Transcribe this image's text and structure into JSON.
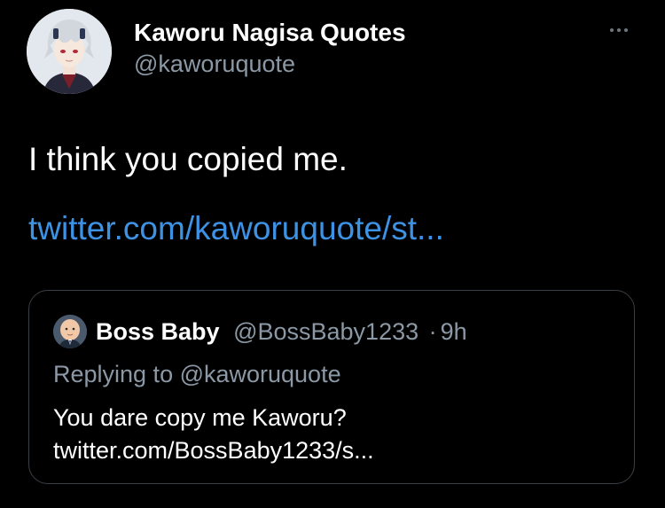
{
  "tweet": {
    "author": {
      "display_name": "Kaworu Nagisa Quotes",
      "handle": "@kaworuquote",
      "avatar_icon": "kaworu-avatar"
    },
    "more_icon": "more-horizontal-icon",
    "text": "I think you copied me.",
    "link": "twitter.com/kaworuquote/st..."
  },
  "quoted_tweet": {
    "display_name": "Boss Baby",
    "handle": "@BossBaby1233",
    "separator": "·",
    "time": "9h",
    "replying_to": "Replying to @kaworuquote",
    "text_line1": "You dare copy me Kaworu?",
    "text_line2": "twitter.com/BossBaby1233/s...",
    "avatar_icon": "boss-baby-avatar"
  },
  "colors": {
    "background": "#000000",
    "primary_text": "#ffffff",
    "secondary_text": "#8b98a5",
    "link": "#3d92e4",
    "border": "#3a3f45"
  }
}
